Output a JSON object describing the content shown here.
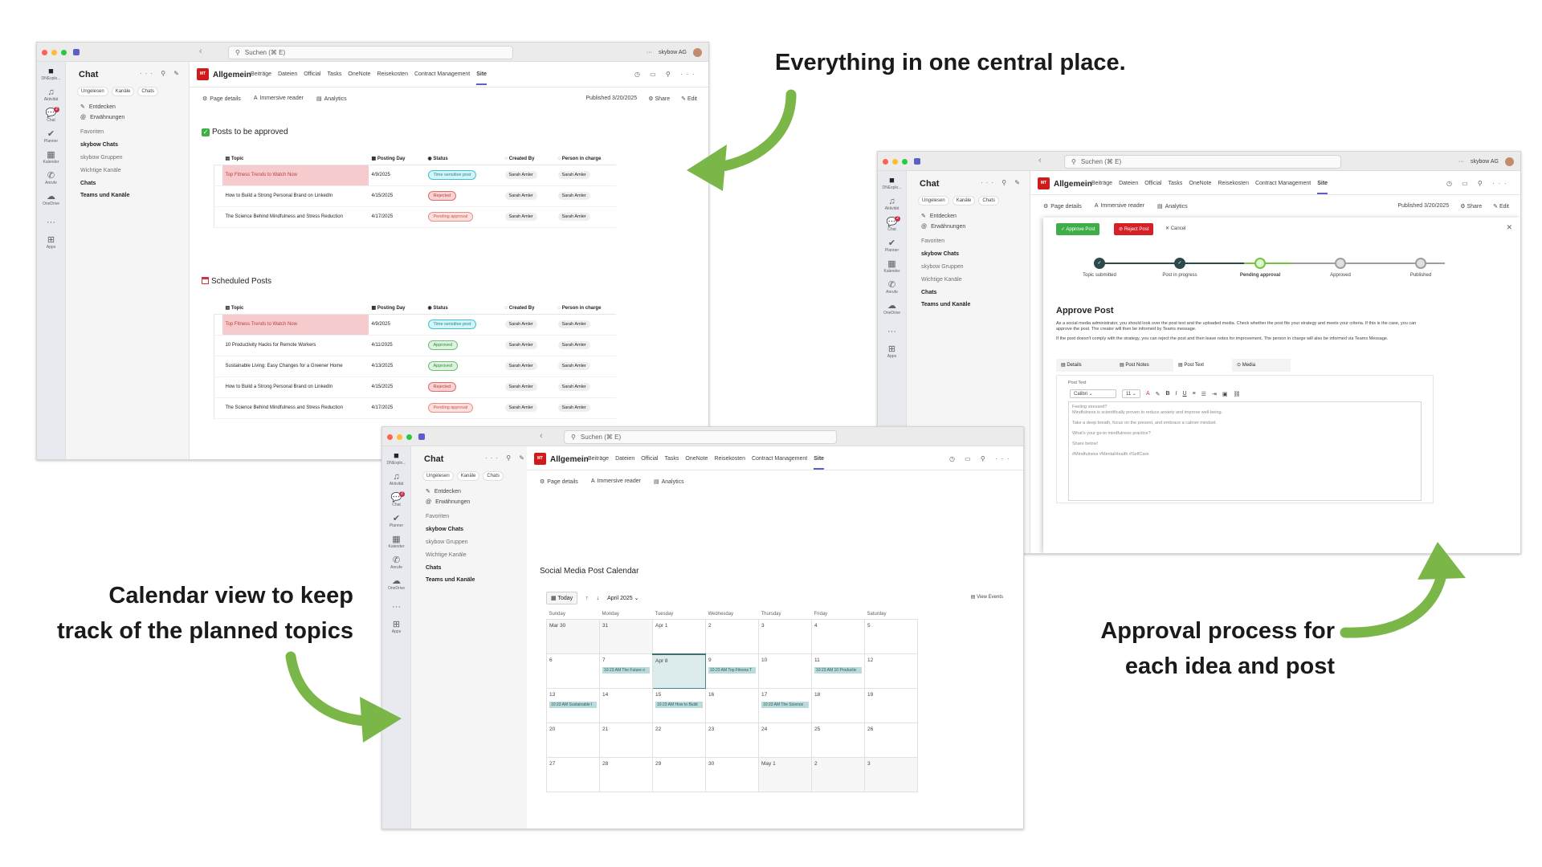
{
  "captions": {
    "top": "Everything in one central place.",
    "left_line1": "Calendar view to keep",
    "left_line2": "track of the planned topics",
    "right_line1": "Approval process for",
    "right_line2": "each idea and post"
  },
  "colors": {
    "accent": "#5b5fc7",
    "arrow": "#7ab648",
    "brand": "#d11a1a",
    "approve": "#3fae49",
    "reject": "#d52028"
  },
  "teams": {
    "search_placeholder": "Suchen (⌘ E)",
    "org": "skybow AG",
    "org_short": "DNExplo...",
    "rail": [
      {
        "label": "Aktivität",
        "icon": "bell-icon"
      },
      {
        "label": "Chat",
        "icon": "chat-icon",
        "badge": "2"
      },
      {
        "label": "Planner",
        "icon": "planner-icon"
      },
      {
        "label": "Kalender",
        "icon": "calendar-icon"
      },
      {
        "label": "Anrufe",
        "icon": "phone-icon"
      },
      {
        "label": "OneDrive",
        "icon": "cloud-icon"
      },
      {
        "label": "...",
        "icon": "more-icon"
      },
      {
        "label": "Apps",
        "icon": "apps-icon"
      }
    ],
    "chat_title": "Chat",
    "filters": [
      "Ungelesen",
      "Kanäle",
      "Chats"
    ],
    "list": {
      "entdecken": "Entdecken",
      "erwaehnungen": "Erwähnungen",
      "favoriten": "Favoriten",
      "skybow_chats": "skybow Chats",
      "skybow_gruppen": "skybow Gruppen",
      "wichtige": "Wichtige Kanäle",
      "chats": "Chats",
      "teams": "Teams und Kanäle"
    },
    "logo_text": "MT",
    "channel": "Allgemein",
    "tabs": [
      "Beiträge",
      "Dateien",
      "Official",
      "Tasks",
      "OneNote",
      "Reisekosten",
      "Contract Management",
      "Site"
    ],
    "toolbar": {
      "page_details": "Page details",
      "reader": "Immersive reader",
      "analytics": "Analytics",
      "published": "Published 3/20/2025",
      "share": "Share",
      "edit": "Edit"
    }
  },
  "approve_list": {
    "title": "Posts to be approved",
    "columns": [
      "Topic",
      "Posting Day",
      "Status",
      "Created By",
      "Person in charge"
    ],
    "rows": [
      {
        "topic": "Top Fitness Trends to Watch Now",
        "day": "4/9/2025",
        "status": "Time sensitive post",
        "created": "Sarah Amler",
        "person": "Sarah Amler"
      },
      {
        "topic": "How to Build a Strong Personal Brand on LinkedIn",
        "day": "4/15/2025",
        "status": "Rejected",
        "created": "Sarah Amler",
        "person": "Sarah Amler"
      },
      {
        "topic": "The Science Behind Mindfulness and Stress Reduction",
        "day": "4/17/2025",
        "status": "Pending approval",
        "created": "Sarah Amler",
        "person": "Sarah Amler"
      }
    ]
  },
  "scheduled_list": {
    "title": "Scheduled Posts",
    "columns": [
      "Topic",
      "Posting Day",
      "Status",
      "Created By",
      "Person in charge"
    ],
    "rows": [
      {
        "topic": "Top Fitness Trends to Watch Now",
        "day": "4/9/2025",
        "status": "Time sensitive post",
        "created": "Sarah Amler",
        "person": "Sarah Amler"
      },
      {
        "topic": "10 Productivity Hacks for Remote Workers",
        "day": "4/11/2025",
        "status": "Approved",
        "created": "Sarah Amler",
        "person": "Sarah Amler"
      },
      {
        "topic": "Sustainable Living: Easy Changes for a Greener Home",
        "day": "4/13/2025",
        "status": "Approved",
        "created": "Sarah Amler",
        "person": "Sarah Amler"
      },
      {
        "topic": "How to Build a Strong Personal Brand on LinkedIn",
        "day": "4/15/2025",
        "status": "Rejected",
        "created": "Sarah Amler",
        "person": "Sarah Amler"
      },
      {
        "topic": "The Science Behind Mindfulness and Stress Reduction",
        "day": "4/17/2025",
        "status": "Pending approval",
        "created": "Sarah Amler",
        "person": "Sarah Amler"
      }
    ]
  },
  "calendar": {
    "title": "Social Media Post Calendar",
    "today_label": "Today",
    "month": "April 2025",
    "view_events": "View Events",
    "days": [
      "Sunday",
      "Monday",
      "Tuesday",
      "Wednesday",
      "Thursday",
      "Friday",
      "Saturday"
    ],
    "weeks": [
      [
        {
          "d": "Mar 30",
          "g": 1
        },
        {
          "d": "31",
          "g": 1
        },
        {
          "d": "Apr 1"
        },
        {
          "d": "2"
        },
        {
          "d": "3"
        },
        {
          "d": "4"
        },
        {
          "d": "5"
        }
      ],
      [
        {
          "d": "6"
        },
        {
          "d": "7",
          "ev": "10:23 AM The Future o"
        },
        {
          "d": "Apr 8",
          "today": 1
        },
        {
          "d": "9",
          "ev": "10:23 AM Top Fitness T"
        },
        {
          "d": "10"
        },
        {
          "d": "11",
          "ev": "10:23 AM 10 Productiv"
        },
        {
          "d": "12"
        }
      ],
      [
        {
          "d": "13",
          "ev": "10:23 AM Sustainable l"
        },
        {
          "d": "14"
        },
        {
          "d": "15",
          "ev": "10:23 AM How to Build"
        },
        {
          "d": "16"
        },
        {
          "d": "17",
          "ev": "10:23 AM The Science"
        },
        {
          "d": "18"
        },
        {
          "d": "19"
        }
      ],
      [
        {
          "d": "20"
        },
        {
          "d": "21"
        },
        {
          "d": "22"
        },
        {
          "d": "23"
        },
        {
          "d": "24"
        },
        {
          "d": "25"
        },
        {
          "d": "26"
        }
      ],
      [
        {
          "d": "27"
        },
        {
          "d": "28"
        },
        {
          "d": "29"
        },
        {
          "d": "30"
        },
        {
          "d": "May 1",
          "g": 1
        },
        {
          "d": "2",
          "g": 1
        },
        {
          "d": "3",
          "g": 1
        }
      ]
    ]
  },
  "approval": {
    "approve_btn": "Approve Post",
    "reject_btn": "Reject Post",
    "cancel": "Cancel",
    "steps": [
      "Topic submitted",
      "Post in progress",
      "Pending approval",
      "Approved",
      "Published"
    ],
    "heading": "Approve Post",
    "desc1": "As a social media administrator, you should look over the post text and the uploaded media. Check whether the post fits your strategy and meets your criteria. If this is the case, you can approve the post. The creator will then be informed by Teams message.",
    "desc2": "If the post doesn't comply with the strategy, you can reject the post and then leave notes for improvement. The person in charge will also be informed via Teams Message.",
    "tabs": [
      "Details",
      "Post Notes",
      "Post Text",
      "Media"
    ],
    "field_label": "Post Text",
    "font": "Calibri",
    "size": "11",
    "text_lines": [
      "Feeling stressed?",
      "Mindfulness is scientifically proven to reduce anxiety and improve well-being.",
      "Take a deep breath, focus on the present, and embrace a calmer mindset.",
      "What's your go-to mindfulness practice?",
      "Share below!",
      "#Mindfulness #MentalHealth #SelfCare"
    ]
  }
}
